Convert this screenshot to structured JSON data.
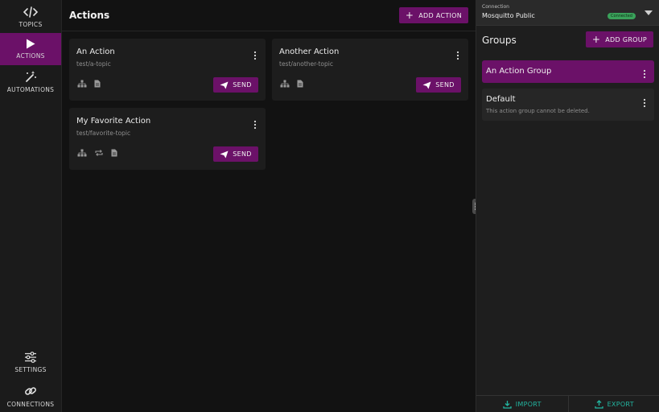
{
  "nav": {
    "items": [
      {
        "label": "TOPICS",
        "icon": "code-icon"
      },
      {
        "label": "ACTIONS",
        "icon": "play-icon"
      },
      {
        "label": "AUTOMATIONS",
        "icon": "magic-wand-icon"
      },
      {
        "label": "SETTINGS",
        "icon": "sliders-icon"
      },
      {
        "label": "CONNECTIONS",
        "icon": "link-icon"
      }
    ],
    "active": "ACTIONS"
  },
  "main": {
    "title": "Actions",
    "add_action_label": "ADD ACTION",
    "send_label": "SEND",
    "actions": [
      {
        "title": "An Action",
        "topic": "test/a-topic",
        "icons": [
          "hierarchy-icon",
          "document-icon"
        ]
      },
      {
        "title": "Another Action",
        "topic": "test/another-topic",
        "icons": [
          "hierarchy-icon",
          "document-icon"
        ]
      },
      {
        "title": "My Favorite Action",
        "topic": "test/favorite-topic",
        "icons": [
          "hierarchy-icon",
          "repeat-icon",
          "document-icon"
        ]
      }
    ]
  },
  "right_panel": {
    "connection_label": "Connection",
    "connection_name": "Mosquitto Public",
    "connection_status": "Connected",
    "groups_title": "Groups",
    "add_group_label": "ADD GROUP",
    "groups": [
      {
        "name": "An Action Group",
        "subtitle": "",
        "selected": true
      },
      {
        "name": "Default",
        "subtitle": "This action group cannot be deleted.",
        "selected": false
      }
    ],
    "import_label": "IMPORT",
    "export_label": "EXPORT"
  },
  "colors": {
    "accent": "#6b1168",
    "teal": "#23b5a0",
    "status_green": "#3aa15a"
  }
}
